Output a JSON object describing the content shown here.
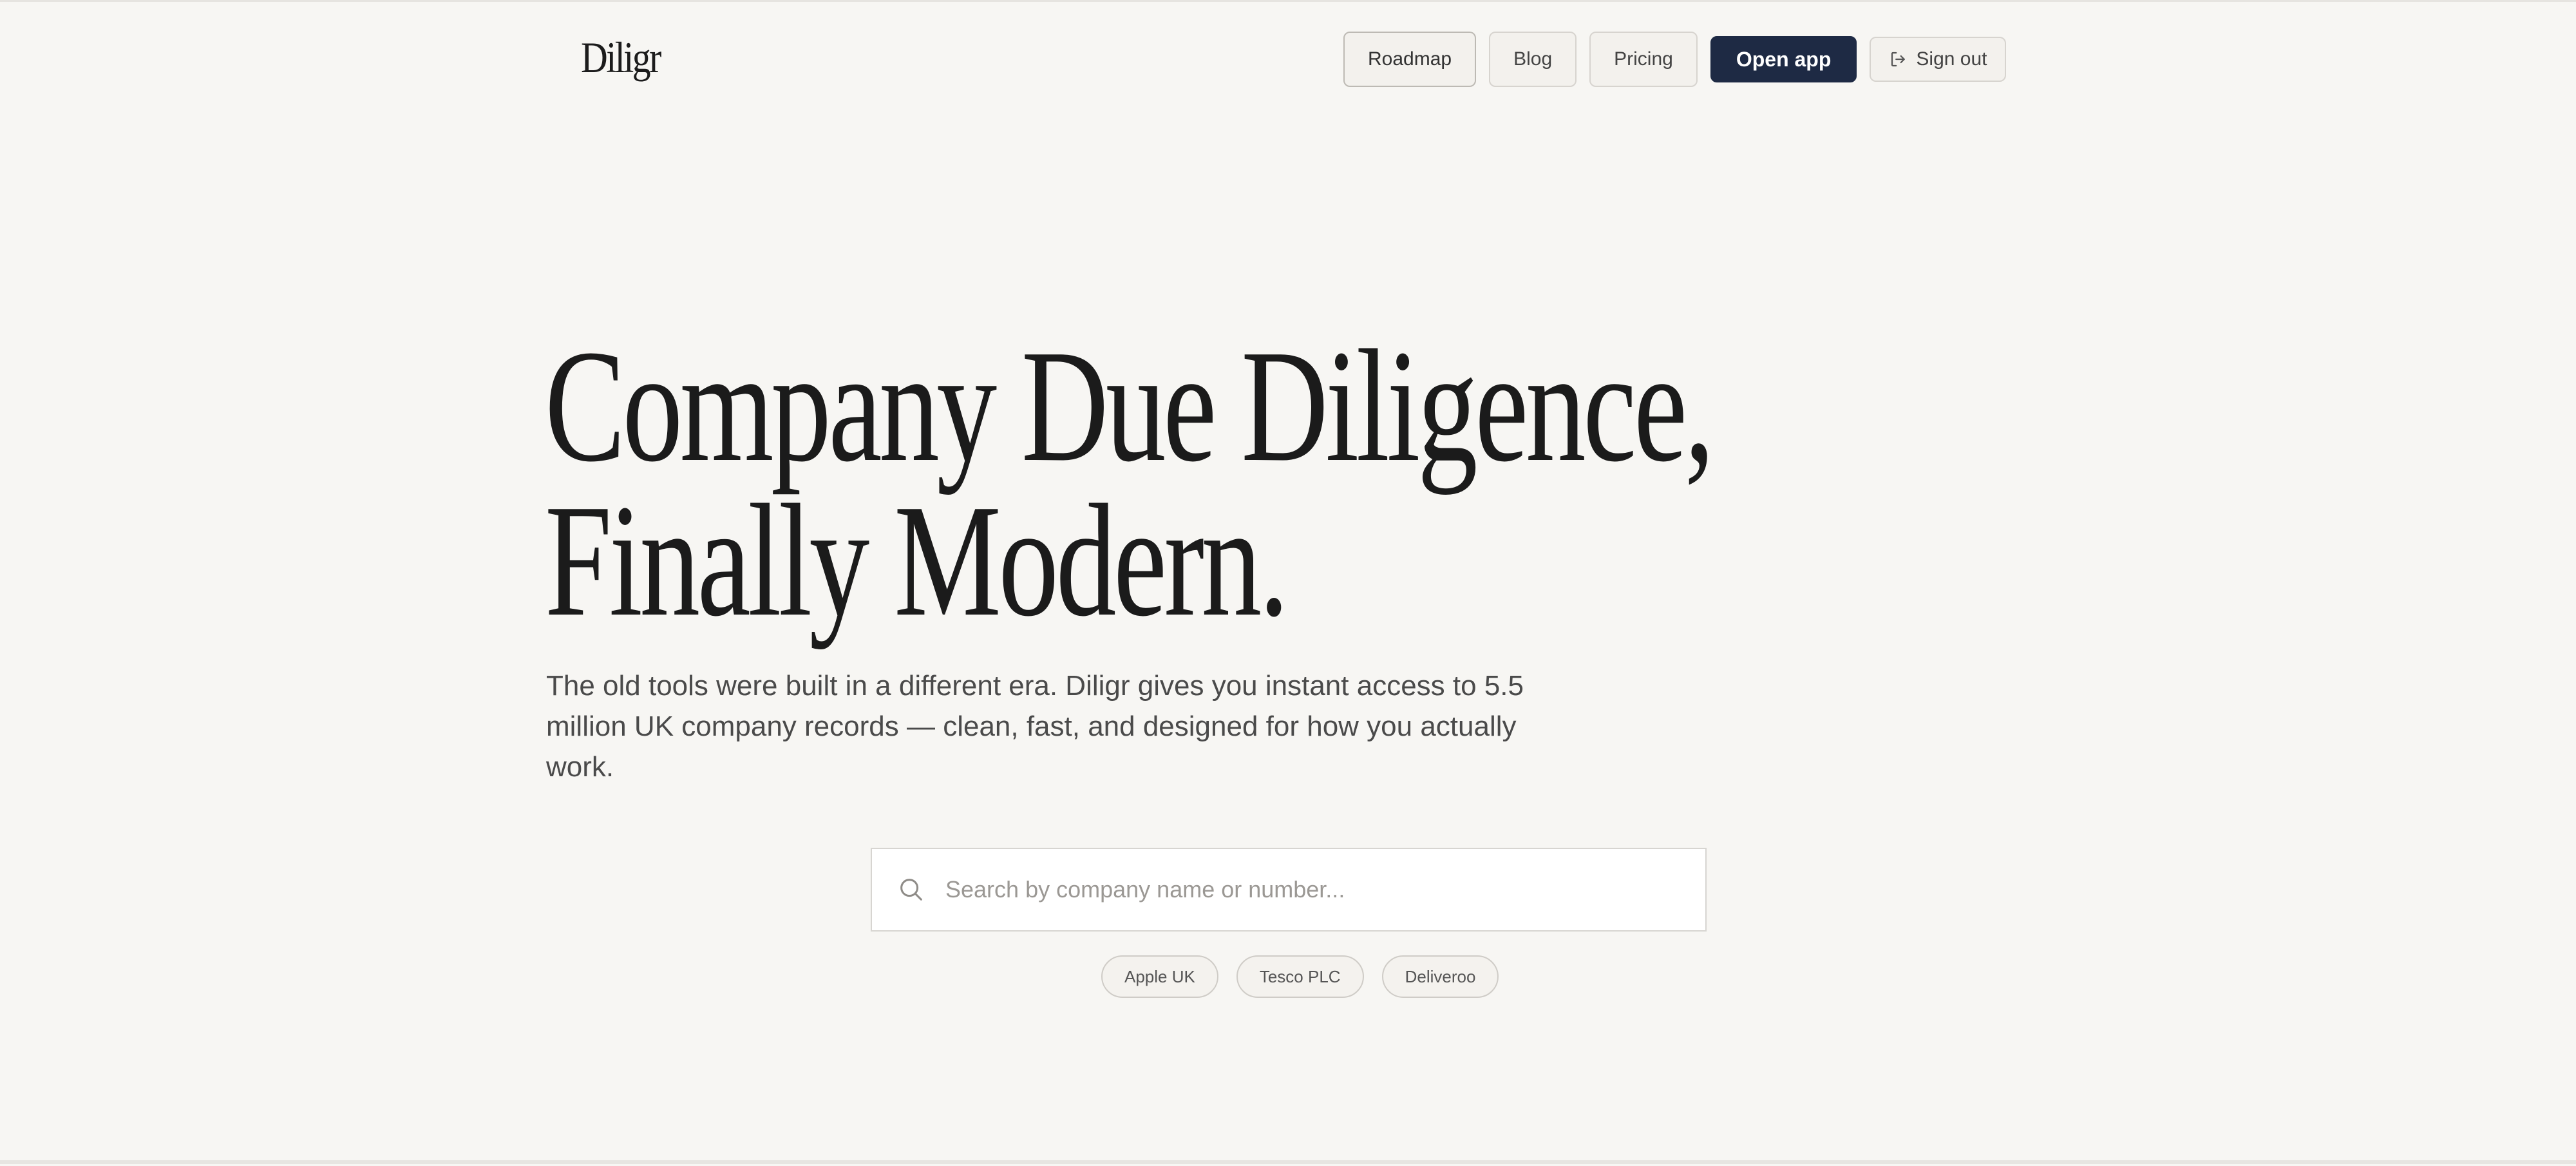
{
  "header": {
    "logo": "Diligr",
    "nav": {
      "roadmap": "Roadmap",
      "blog": "Blog",
      "pricing": "Pricing",
      "open_app": "Open app",
      "sign_out": "Sign out"
    }
  },
  "hero": {
    "title_line1": "Company Due Diligence,",
    "title_line2": "Finally Modern.",
    "subtitle": "The old tools were built in a different era. Diligr gives you instant access to 5.5 million UK company records — clean, fast, and designed for how you actually work."
  },
  "search": {
    "placeholder": "Search by company name or number..."
  },
  "suggestions": [
    "Apple UK",
    "Tesco PLC",
    "Deliveroo"
  ],
  "icons": {
    "search": "search-icon",
    "sign_out": "sign-out-icon"
  },
  "colors": {
    "background": "#f7f6f3",
    "primary_button": "#1e2a44",
    "text": "#1b1b1b"
  }
}
